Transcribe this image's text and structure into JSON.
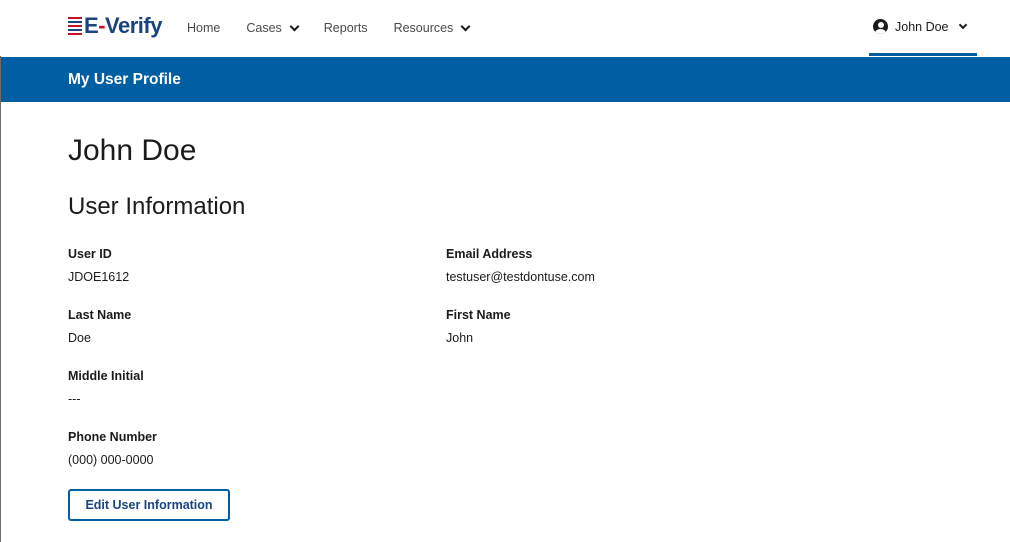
{
  "brand": {
    "logo_text_e": "E",
    "logo_text_dash": "-",
    "logo_text_rest": "Verify"
  },
  "nav": {
    "home": "Home",
    "cases": "Cases",
    "reports": "Reports",
    "resources": "Resources"
  },
  "user_menu": {
    "name": "John Doe"
  },
  "banner": {
    "title": "My User Profile"
  },
  "profile": {
    "name": "John Doe",
    "section_title": "User Information",
    "fields": {
      "user_id": {
        "label": "User ID",
        "value": "JDOE1612"
      },
      "email": {
        "label": "Email Address",
        "value": "testuser@testdontuse.com"
      },
      "last_name": {
        "label": "Last Name",
        "value": "Doe"
      },
      "first_name": {
        "label": "First Name",
        "value": "John"
      },
      "middle_initial": {
        "label": "Middle Initial",
        "value": "---"
      },
      "phone": {
        "label": "Phone Number",
        "value": "(000) 000-0000"
      }
    },
    "edit_button": "Edit User Information"
  },
  "colors": {
    "primary": "#005ea2",
    "brand_blue": "#1a4480",
    "brand_red": "#c8102e"
  }
}
